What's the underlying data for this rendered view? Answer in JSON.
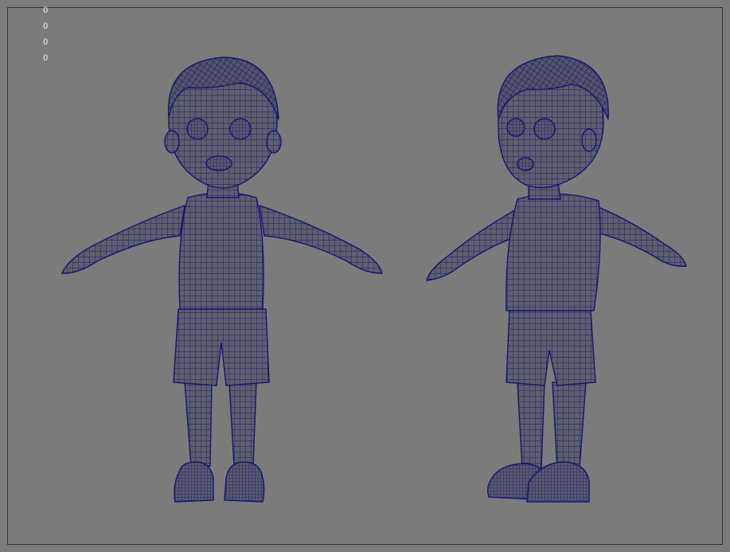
{
  "viewport": {
    "hud_values": [
      "0",
      "0",
      "0",
      "0"
    ],
    "background_color": "#7b7b7b",
    "frame_color": "#1e3f2a",
    "wire_color": "#1a1a7a",
    "shade_color": "#5c5c68"
  }
}
